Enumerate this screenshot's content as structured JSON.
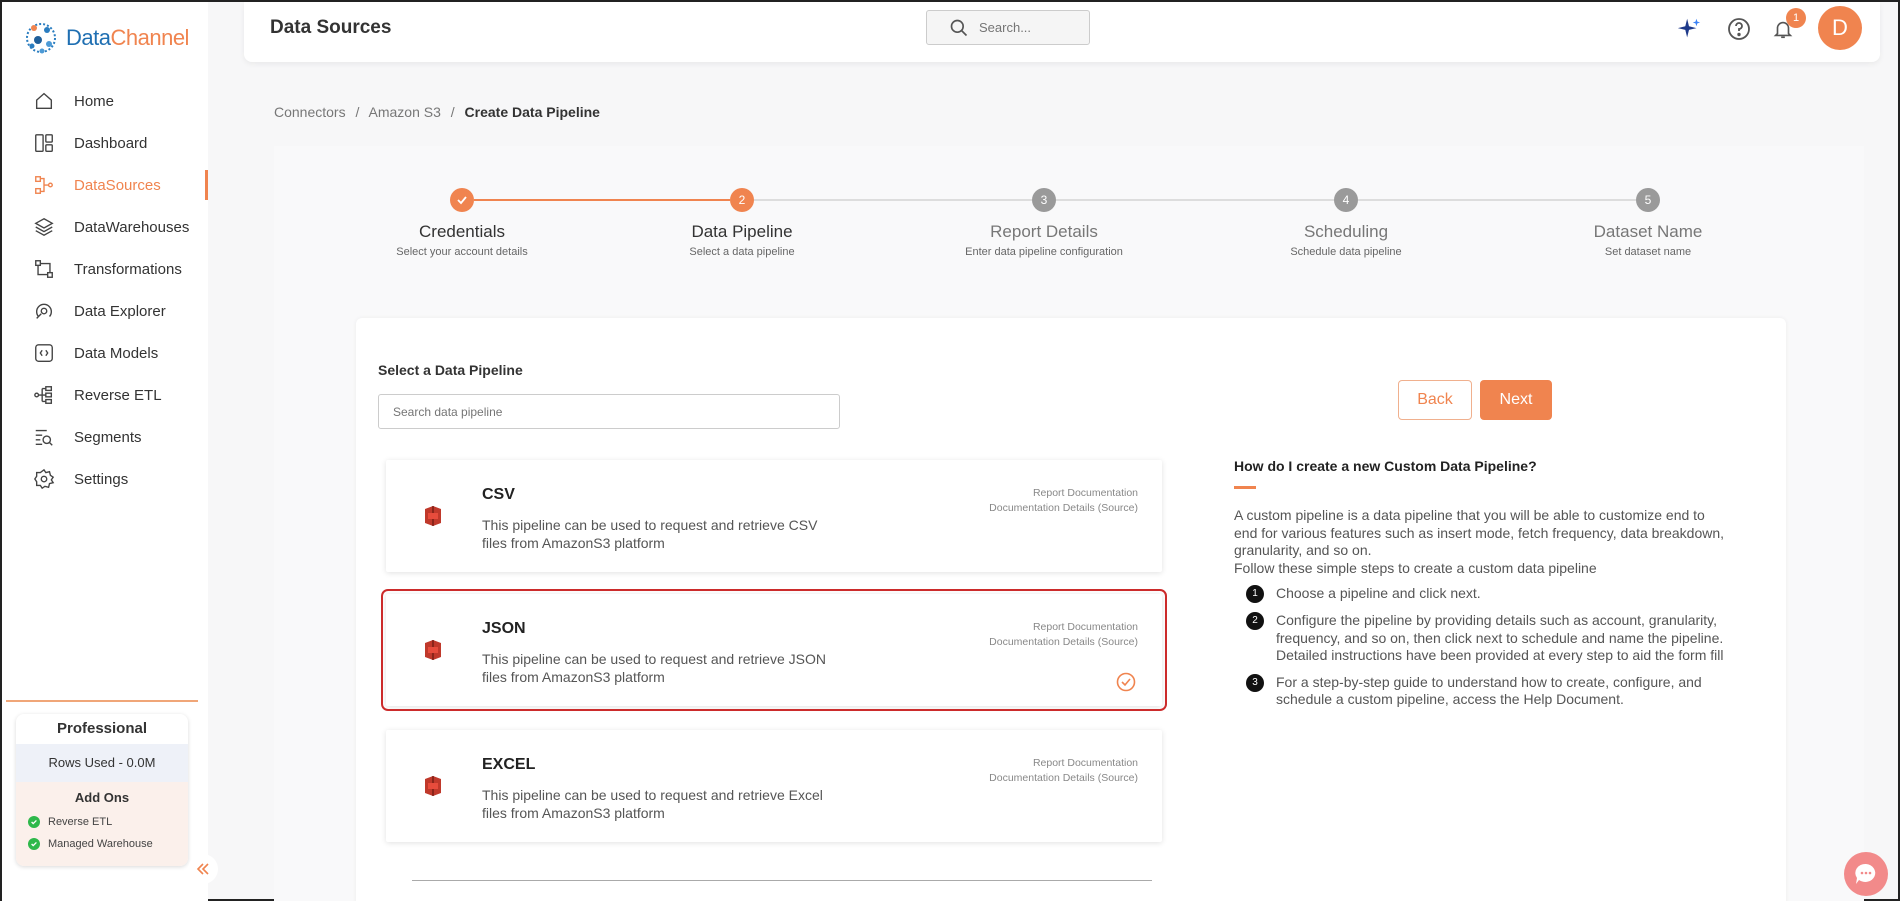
{
  "brand": {
    "name_part1": "Data",
    "name_part2": "Channel"
  },
  "sidebar": {
    "items": [
      {
        "label": "Home",
        "icon": "home-icon"
      },
      {
        "label": "Dashboard",
        "icon": "dashboard-icon"
      },
      {
        "label": "DataSources",
        "icon": "datasources-icon",
        "active": true
      },
      {
        "label": "DataWarehouses",
        "icon": "layers-icon"
      },
      {
        "label": "Transformations",
        "icon": "transform-icon"
      },
      {
        "label": "Data Explorer",
        "icon": "explorer-icon"
      },
      {
        "label": "Data Models",
        "icon": "models-icon"
      },
      {
        "label": "Reverse ETL",
        "icon": "reverse-etl-icon"
      },
      {
        "label": "Segments",
        "icon": "segments-icon"
      },
      {
        "label": "Settings",
        "icon": "gear-icon"
      }
    ],
    "plan": {
      "title": "Professional",
      "rows_used": "Rows Used - 0.0M",
      "addons_title": "Add Ons",
      "addons": [
        "Reverse ETL",
        "Managed Warehouse"
      ]
    }
  },
  "header": {
    "title": "Data Sources",
    "search_placeholder": "Search...",
    "notification_count": "1",
    "avatar_initial": "D"
  },
  "breadcrumb": {
    "items": [
      "Connectors",
      "Amazon S3"
    ],
    "current": "Create Data Pipeline",
    "separator": "/"
  },
  "stepper": [
    {
      "number": "1",
      "title": "Credentials",
      "sub": "Select your account details",
      "state": "done"
    },
    {
      "number": "2",
      "title": "Data Pipeline",
      "sub": "Select a data pipeline",
      "state": "active"
    },
    {
      "number": "3",
      "title": "Report Details",
      "sub": "Enter data pipeline configuration",
      "state": "todo"
    },
    {
      "number": "4",
      "title": "Scheduling",
      "sub": "Schedule data pipeline",
      "state": "todo"
    },
    {
      "number": "5",
      "title": "Dataset Name",
      "sub": "Set dataset name",
      "state": "todo"
    }
  ],
  "main": {
    "select_label": "Select a Data Pipeline",
    "search_placeholder": "Search data pipeline",
    "back_label": "Back",
    "next_label": "Next",
    "pipelines": [
      {
        "name": "CSV",
        "desc": "This pipeline can be used to request and retrieve CSV files from AmazonS3 platform",
        "link1": "Report Documentation",
        "link2": "Documentation Details (Source)",
        "selected": false
      },
      {
        "name": "JSON",
        "desc": "This pipeline can be used to request and retrieve JSON files from AmazonS3 platform",
        "link1": "Report Documentation",
        "link2": "Documentation Details (Source)",
        "selected": true
      },
      {
        "name": "EXCEL",
        "desc": "This pipeline can be used to request and retrieve Excel files from AmazonS3 platform",
        "link1": "Report Documentation",
        "link2": "Documentation Details (Source)",
        "selected": false
      }
    ]
  },
  "help": {
    "title": "How do I create a new Custom Data Pipeline?",
    "intro": "A custom pipeline is a data pipeline that you will be able to customize end to end for various features such as insert mode, fetch frequency, data breakdown, granularity, and so on.",
    "follow": "Follow these simple steps to create a custom data pipeline",
    "steps": [
      {
        "num": "1",
        "text": "Choose a pipeline and click next."
      },
      {
        "num": "2",
        "text": "Configure the pipeline by providing details such as account, granularity, frequency, and so on, then click next to schedule and name the pipeline. Detailed instructions have been provided at every step to aid the form fill"
      },
      {
        "num": "3",
        "text": "For a step-by-step guide to understand how to create, configure, and schedule a custom pipeline, access the Help Document."
      }
    ]
  },
  "colors": {
    "accent": "#f0844f",
    "selected_outline": "#cc2b2b",
    "check_green": "#2eb84b",
    "chat": "#f28a8a"
  }
}
